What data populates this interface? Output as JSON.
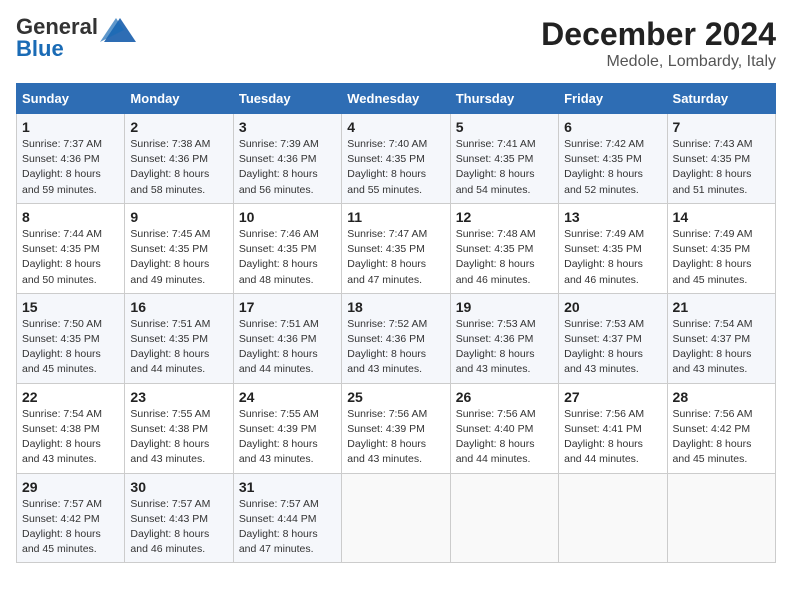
{
  "header": {
    "logo_general": "General",
    "logo_blue": "Blue",
    "title": "December 2024",
    "subtitle": "Medole, Lombardy, Italy"
  },
  "calendar": {
    "days_of_week": [
      "Sunday",
      "Monday",
      "Tuesday",
      "Wednesday",
      "Thursday",
      "Friday",
      "Saturday"
    ],
    "weeks": [
      [
        null,
        {
          "day": "2",
          "sunrise": "7:38 AM",
          "sunset": "4:36 PM",
          "daylight": "8 hours and 58 minutes."
        },
        {
          "day": "3",
          "sunrise": "7:39 AM",
          "sunset": "4:36 PM",
          "daylight": "8 hours and 56 minutes."
        },
        {
          "day": "4",
          "sunrise": "7:40 AM",
          "sunset": "4:35 PM",
          "daylight": "8 hours and 55 minutes."
        },
        {
          "day": "5",
          "sunrise": "7:41 AM",
          "sunset": "4:35 PM",
          "daylight": "8 hours and 54 minutes."
        },
        {
          "day": "6",
          "sunrise": "7:42 AM",
          "sunset": "4:35 PM",
          "daylight": "8 hours and 52 minutes."
        },
        {
          "day": "7",
          "sunrise": "7:43 AM",
          "sunset": "4:35 PM",
          "daylight": "8 hours and 51 minutes."
        }
      ],
      [
        {
          "day": "1",
          "sunrise": "7:37 AM",
          "sunset": "4:36 PM",
          "daylight": "8 hours and 59 minutes."
        },
        {
          "day": "9",
          "sunrise": "7:45 AM",
          "sunset": "4:35 PM",
          "daylight": "8 hours and 49 minutes."
        },
        {
          "day": "10",
          "sunrise": "7:46 AM",
          "sunset": "4:35 PM",
          "daylight": "8 hours and 48 minutes."
        },
        {
          "day": "11",
          "sunrise": "7:47 AM",
          "sunset": "4:35 PM",
          "daylight": "8 hours and 47 minutes."
        },
        {
          "day": "12",
          "sunrise": "7:48 AM",
          "sunset": "4:35 PM",
          "daylight": "8 hours and 46 minutes."
        },
        {
          "day": "13",
          "sunrise": "7:49 AM",
          "sunset": "4:35 PM",
          "daylight": "8 hours and 46 minutes."
        },
        {
          "day": "14",
          "sunrise": "7:49 AM",
          "sunset": "4:35 PM",
          "daylight": "8 hours and 45 minutes."
        }
      ],
      [
        {
          "day": "8",
          "sunrise": "7:44 AM",
          "sunset": "4:35 PM",
          "daylight": "8 hours and 50 minutes."
        },
        {
          "day": "16",
          "sunrise": "7:51 AM",
          "sunset": "4:35 PM",
          "daylight": "8 hours and 44 minutes."
        },
        {
          "day": "17",
          "sunrise": "7:51 AM",
          "sunset": "4:36 PM",
          "daylight": "8 hours and 44 minutes."
        },
        {
          "day": "18",
          "sunrise": "7:52 AM",
          "sunset": "4:36 PM",
          "daylight": "8 hours and 43 minutes."
        },
        {
          "day": "19",
          "sunrise": "7:53 AM",
          "sunset": "4:36 PM",
          "daylight": "8 hours and 43 minutes."
        },
        {
          "day": "20",
          "sunrise": "7:53 AM",
          "sunset": "4:37 PM",
          "daylight": "8 hours and 43 minutes."
        },
        {
          "day": "21",
          "sunrise": "7:54 AM",
          "sunset": "4:37 PM",
          "daylight": "8 hours and 43 minutes."
        }
      ],
      [
        {
          "day": "15",
          "sunrise": "7:50 AM",
          "sunset": "4:35 PM",
          "daylight": "8 hours and 45 minutes."
        },
        {
          "day": "23",
          "sunrise": "7:55 AM",
          "sunset": "4:38 PM",
          "daylight": "8 hours and 43 minutes."
        },
        {
          "day": "24",
          "sunrise": "7:55 AM",
          "sunset": "4:39 PM",
          "daylight": "8 hours and 43 minutes."
        },
        {
          "day": "25",
          "sunrise": "7:56 AM",
          "sunset": "4:39 PM",
          "daylight": "8 hours and 43 minutes."
        },
        {
          "day": "26",
          "sunrise": "7:56 AM",
          "sunset": "4:40 PM",
          "daylight": "8 hours and 44 minutes."
        },
        {
          "day": "27",
          "sunrise": "7:56 AM",
          "sunset": "4:41 PM",
          "daylight": "8 hours and 44 minutes."
        },
        {
          "day": "28",
          "sunrise": "7:56 AM",
          "sunset": "4:42 PM",
          "daylight": "8 hours and 45 minutes."
        }
      ],
      [
        {
          "day": "22",
          "sunrise": "7:54 AM",
          "sunset": "4:38 PM",
          "daylight": "8 hours and 43 minutes."
        },
        {
          "day": "30",
          "sunrise": "7:57 AM",
          "sunset": "4:43 PM",
          "daylight": "8 hours and 46 minutes."
        },
        {
          "day": "31",
          "sunrise": "7:57 AM",
          "sunset": "4:44 PM",
          "daylight": "8 hours and 47 minutes."
        },
        null,
        null,
        null,
        null
      ],
      [
        {
          "day": "29",
          "sunrise": "7:57 AM",
          "sunset": "4:42 PM",
          "daylight": "8 hours and 45 minutes."
        },
        null,
        null,
        null,
        null,
        null,
        null
      ]
    ]
  }
}
